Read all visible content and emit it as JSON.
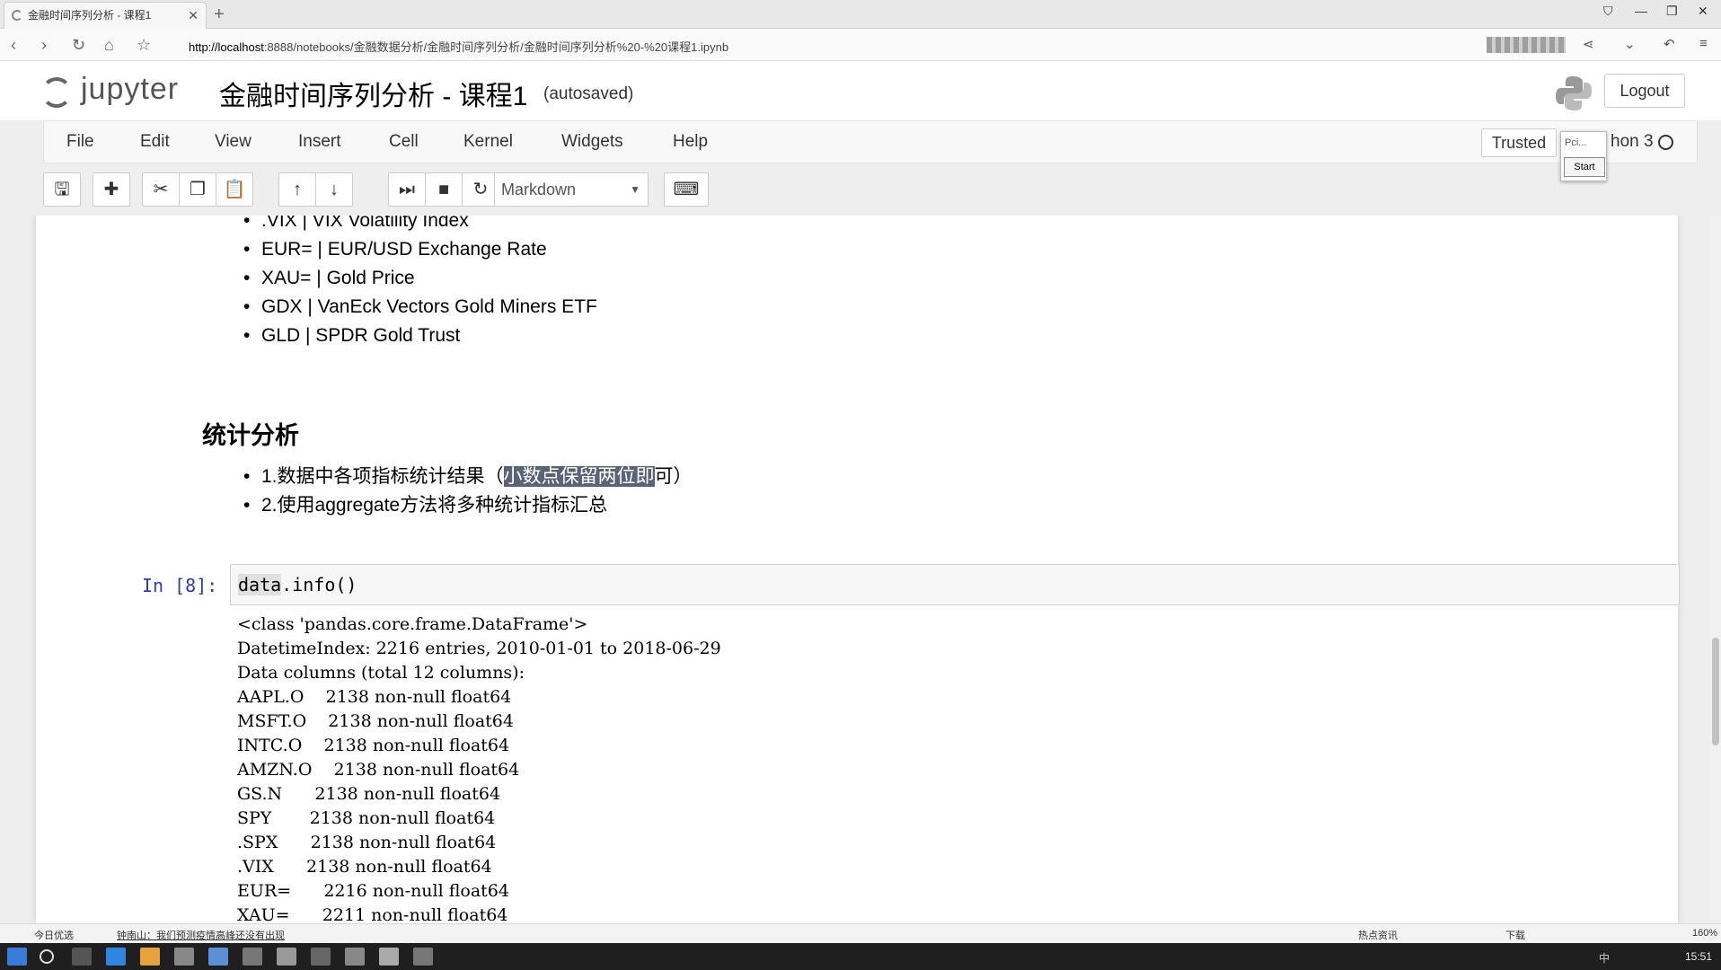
{
  "browser": {
    "tab_title": "金融时间序列分析 - 课程1",
    "url_host": "http://localhost",
    "url_rest": ":8888/notebooks/金融数据分析/金融时间序列分析/金融时间序列分析%20-%20课程1.ipynb"
  },
  "header": {
    "logo_text": "jupyter",
    "notebook_title": "金融时间序列分析 - 课程1",
    "autosave": "(autosaved)",
    "logout": "Logout"
  },
  "menu": {
    "items": [
      "File",
      "Edit",
      "View",
      "Insert",
      "Cell",
      "Kernel",
      "Widgets",
      "Help"
    ],
    "trusted": "Trusted",
    "kernel": "hon 3",
    "popup_text": "Pci...",
    "popup_button": "Start"
  },
  "toolbar": {
    "cell_type": "Markdown"
  },
  "notebook": {
    "bullets_top": [
      ".VIX | VIX Volatility Index",
      "EUR= | EUR/USD Exchange Rate",
      "XAU= | Gold Price",
      "GDX | VanEck Vectors Gold Miners ETF",
      "GLD | SPDR Gold Trust"
    ],
    "section_heading": "统计分析",
    "stat_item1_prefix": "1.数据中各项指标统计结果（",
    "stat_item1_highlight": "小数点保留两位即",
    "stat_item1_suffix": "可）",
    "stat_item2": "2.使用aggregate方法将多种统计指标汇总",
    "prompt": "In  [8]:",
    "code_obj": "data",
    "code_rest": ".info()",
    "output_lines": [
      "<class 'pandas.core.frame.DataFrame'>",
      "DatetimeIndex: 2216 entries, 2010-01-01 to 2018-06-29",
      "Data columns (total 12 columns):",
      "AAPL.O    2138 non-null float64",
      "MSFT.O    2138 non-null float64",
      "INTC.O    2138 non-null float64",
      "AMZN.O    2138 non-null float64",
      "GS.N      2138 non-null float64",
      "SPY       2138 non-null float64",
      ".SPX      2138 non-null float64",
      ".VIX      2138 non-null float64",
      "EUR=      2216 non-null float64",
      "XAU=      2211 non-null float64"
    ]
  },
  "statusbar": {
    "left1": "今日优选",
    "left2": "钟南山：我们预测疫情高峰还没有出现",
    "right1": "热点资讯",
    "right2": "下载",
    "zoom": "160%"
  },
  "taskbar": {
    "ime": "中",
    "clock": "15:51"
  }
}
